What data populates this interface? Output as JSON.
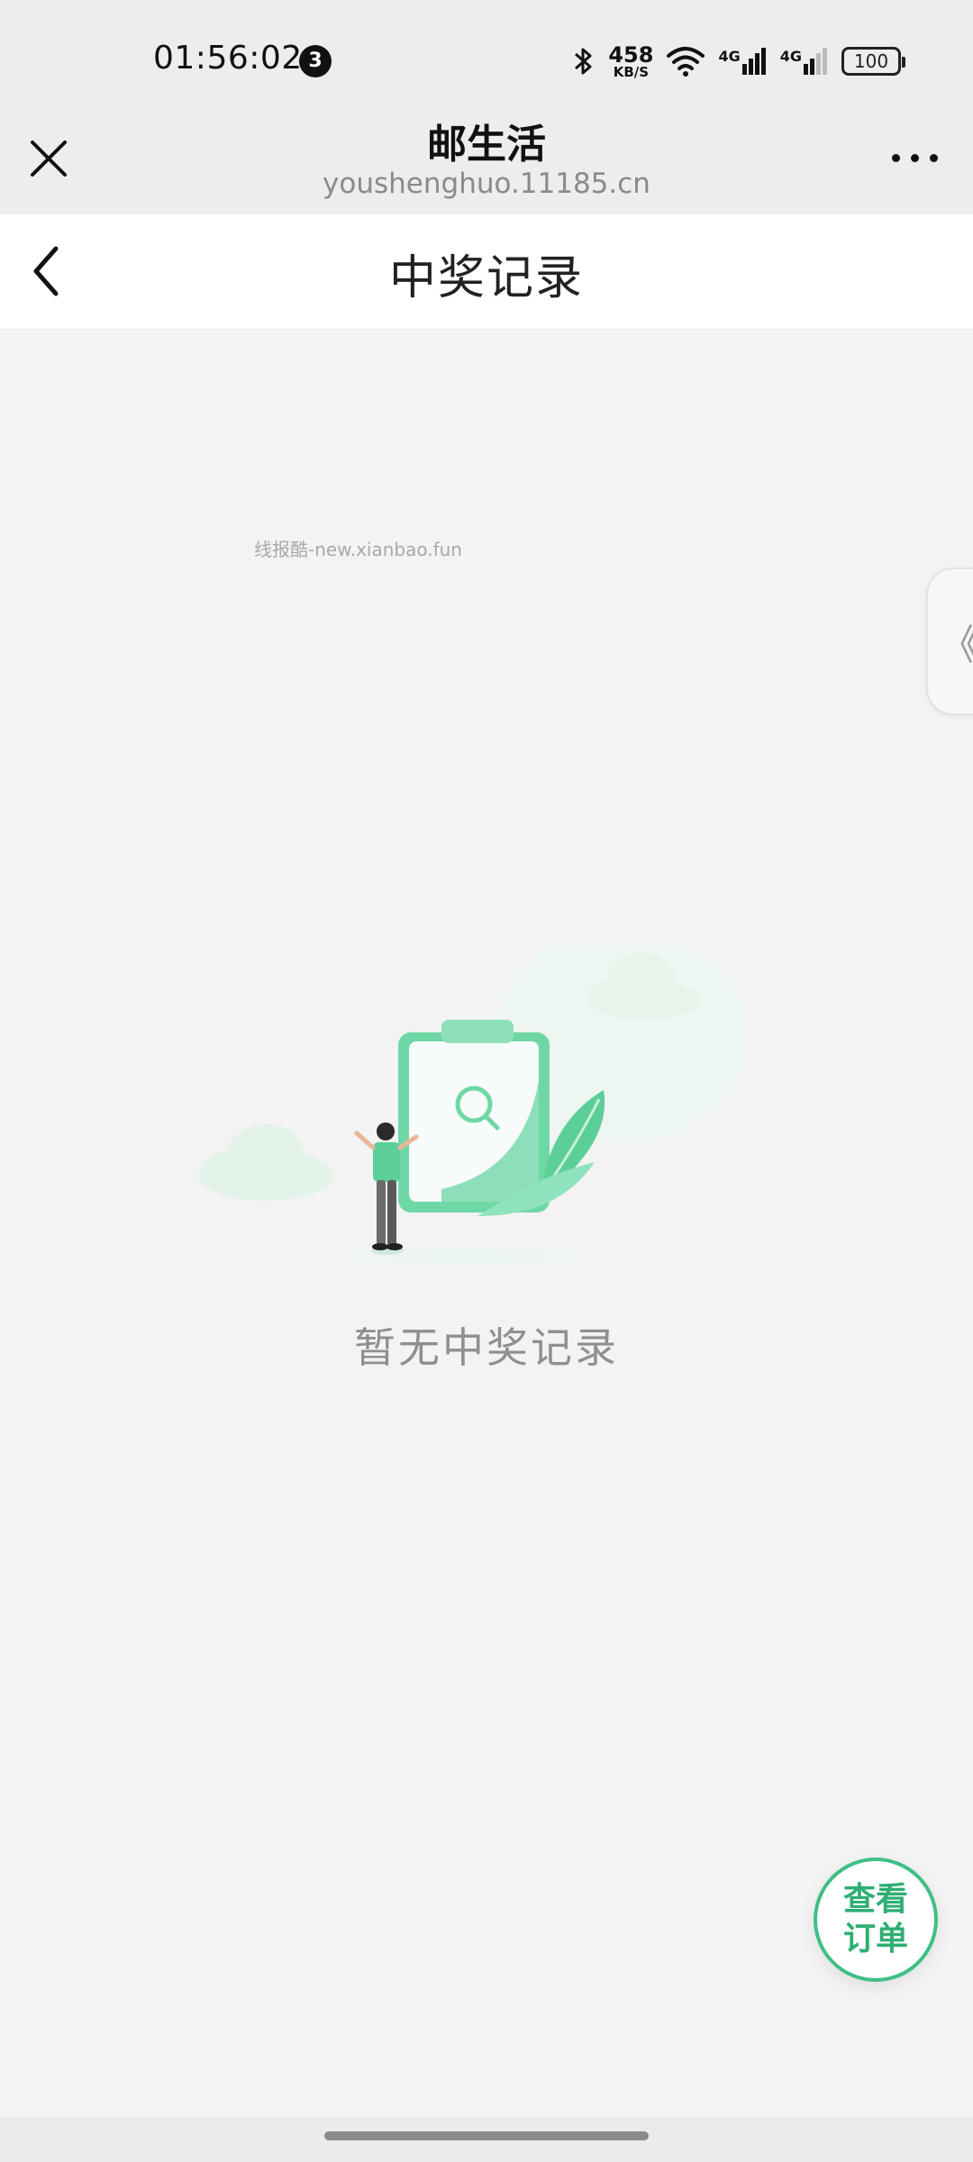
{
  "status_bar": {
    "time": "01:56:02",
    "notification_count": "3",
    "net_speed_value": "458",
    "net_speed_unit": "KB/S",
    "signal_1_label": "4G",
    "signal_2_label": "4G",
    "battery_level": "100"
  },
  "webview_header": {
    "title": "邮生活",
    "url": "youshenghuo.11185.cn"
  },
  "page_nav": {
    "title": "中奖记录"
  },
  "watermark": "线报酷-new.xianbao.fun",
  "side_tab_glyph": "《",
  "empty_state": {
    "message": "暂无中奖记录"
  },
  "fab": {
    "label": "查看订单"
  },
  "colors": {
    "accent_green": "#3fbf86",
    "background": "#f3f3f3"
  }
}
